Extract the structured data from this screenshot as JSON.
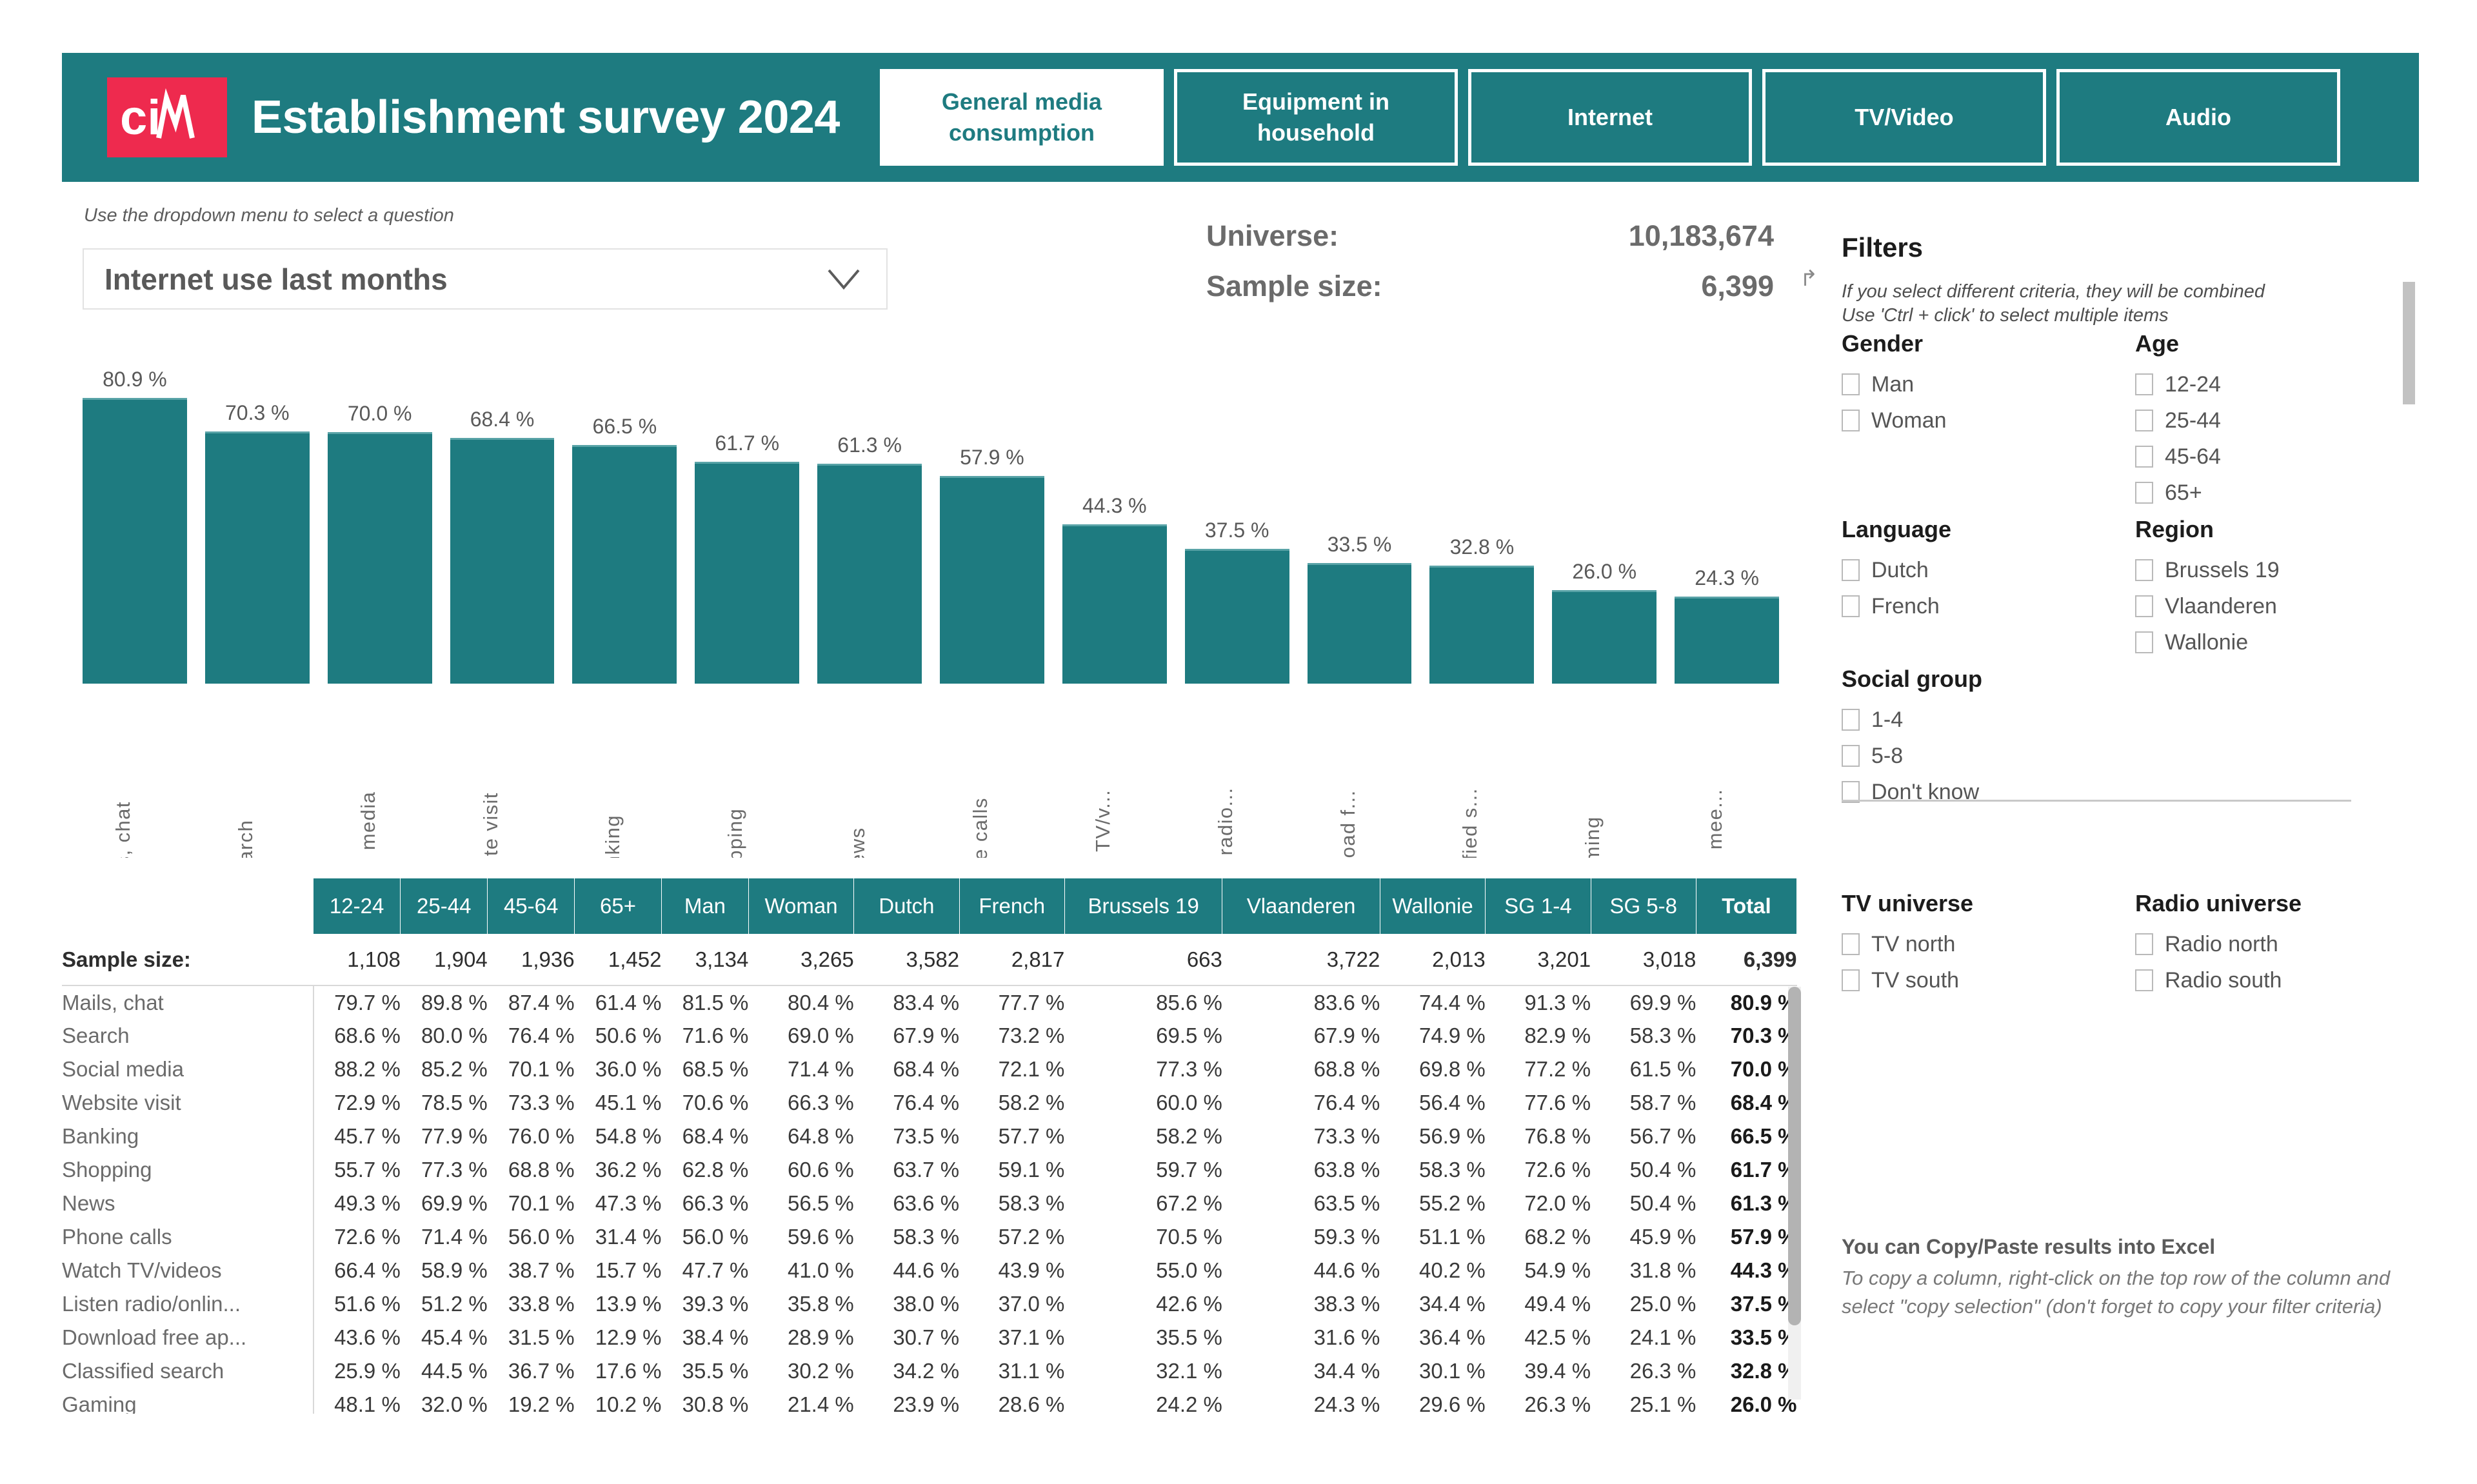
{
  "header": {
    "logo_text": "ciM",
    "title": "Establishment survey 2024",
    "tabs": [
      {
        "label": "General media consumption",
        "active": true
      },
      {
        "label": "Equipment in household",
        "active": false
      },
      {
        "label": "Internet",
        "active": false
      },
      {
        "label": "TV/Video",
        "active": false
      },
      {
        "label": "Audio",
        "active": false
      }
    ]
  },
  "question": {
    "hint": "Use the dropdown menu to select a question",
    "selected": "Internet use last months",
    "chevron_icon": "chevron-down-icon"
  },
  "stats": {
    "universe_label": "Universe:",
    "universe_value": "10,183,674",
    "sample_label": "Sample size:",
    "sample_value": "6,399",
    "marker": "↱"
  },
  "chart_data": {
    "type": "bar",
    "title": "Internet use last months",
    "xlabel": "",
    "ylabel": "",
    "ylim": [
      0,
      100
    ],
    "grid": false,
    "legend": "none",
    "categories": [
      "Mails, chat",
      "Search",
      "Social media",
      "Website visit",
      "Banking",
      "Shopping",
      "News",
      "Phone calls",
      "Watch TV/v...",
      "Listen radio...",
      "Download f...",
      "Classified s...",
      "Gaming",
      "Online mee..."
    ],
    "values": [
      80.9,
      70.3,
      70.0,
      68.4,
      66.5,
      61.7,
      61.3,
      57.9,
      44.3,
      37.5,
      33.5,
      32.8,
      26.0,
      24.3
    ],
    "value_labels": [
      "80.9 %",
      "70.3 %",
      "70.0 %",
      "68.4 %",
      "66.5 %",
      "61.7 %",
      "61.3 %",
      "57.9 %",
      "44.3 %",
      "37.5 %",
      "33.5 %",
      "32.8 %",
      "26.0 %",
      "24.3 %"
    ],
    "bar_color": "#1e7b80"
  },
  "table": {
    "row_header_label": "",
    "columns": [
      "12-24",
      "25-44",
      "45-64",
      "65+",
      "Man",
      "Woman",
      "Dutch",
      "French",
      "Brussels 19",
      "Vlaanderen",
      "Wallonie",
      "SG 1-4",
      "SG 5-8",
      "Total"
    ],
    "sample_size": {
      "label": "Sample size:",
      "values": [
        "1,108",
        "1,904",
        "1,936",
        "1,452",
        "3,134",
        "3,265",
        "3,582",
        "2,817",
        "663",
        "3,722",
        "2,013",
        "3,201",
        "3,018",
        "6,399"
      ]
    },
    "rows": [
      {
        "label": "Mails, chat",
        "values": [
          "79.7 %",
          "89.8 %",
          "87.4 %",
          "61.4 %",
          "81.5 %",
          "80.4 %",
          "83.4 %",
          "77.7 %",
          "85.6 %",
          "83.6 %",
          "74.4 %",
          "91.3 %",
          "69.9 %",
          "80.9 %"
        ]
      },
      {
        "label": "Search",
        "values": [
          "68.6 %",
          "80.0 %",
          "76.4 %",
          "50.6 %",
          "71.6 %",
          "69.0 %",
          "67.9 %",
          "73.2 %",
          "69.5 %",
          "67.9 %",
          "74.9 %",
          "82.9 %",
          "58.3 %",
          "70.3 %"
        ]
      },
      {
        "label": "Social media",
        "values": [
          "88.2 %",
          "85.2 %",
          "70.1 %",
          "36.0 %",
          "68.5 %",
          "71.4 %",
          "68.4 %",
          "72.1 %",
          "77.3 %",
          "68.8 %",
          "69.8 %",
          "77.2 %",
          "61.5 %",
          "70.0 %"
        ]
      },
      {
        "label": "Website visit",
        "values": [
          "72.9 %",
          "78.5 %",
          "73.3 %",
          "45.1 %",
          "70.6 %",
          "66.3 %",
          "76.4 %",
          "58.2 %",
          "60.0 %",
          "76.4 %",
          "56.4 %",
          "77.6 %",
          "58.7 %",
          "68.4 %"
        ]
      },
      {
        "label": "Banking",
        "values": [
          "45.7 %",
          "77.9 %",
          "76.0 %",
          "54.8 %",
          "68.4 %",
          "64.8 %",
          "73.5 %",
          "57.7 %",
          "58.2 %",
          "73.3 %",
          "56.9 %",
          "76.8 %",
          "56.7 %",
          "66.5 %"
        ]
      },
      {
        "label": "Shopping",
        "values": [
          "55.7 %",
          "77.3 %",
          "68.8 %",
          "36.2 %",
          "62.8 %",
          "60.6 %",
          "63.7 %",
          "59.1 %",
          "59.7 %",
          "63.8 %",
          "58.3 %",
          "72.6 %",
          "50.4 %",
          "61.7 %"
        ]
      },
      {
        "label": "News",
        "values": [
          "49.3 %",
          "69.9 %",
          "70.1 %",
          "47.3 %",
          "66.3 %",
          "56.5 %",
          "63.6 %",
          "58.3 %",
          "67.2 %",
          "63.5 %",
          "55.2 %",
          "72.0 %",
          "50.4 %",
          "61.3 %"
        ]
      },
      {
        "label": "Phone calls",
        "values": [
          "72.6 %",
          "71.4 %",
          "56.0 %",
          "31.4 %",
          "56.0 %",
          "59.6 %",
          "58.3 %",
          "57.2 %",
          "70.5 %",
          "59.3 %",
          "51.1 %",
          "68.2 %",
          "45.9 %",
          "57.9 %"
        ]
      },
      {
        "label": "Watch TV/videos",
        "values": [
          "66.4 %",
          "58.9 %",
          "38.7 %",
          "15.7 %",
          "47.7 %",
          "41.0 %",
          "44.6 %",
          "43.9 %",
          "55.0 %",
          "44.6 %",
          "40.2 %",
          "54.9 %",
          "31.8 %",
          "44.3 %"
        ]
      },
      {
        "label": "Listen radio/onlin...",
        "values": [
          "51.6 %",
          "51.2 %",
          "33.8 %",
          "13.9 %",
          "39.3 %",
          "35.8 %",
          "38.0 %",
          "37.0 %",
          "42.6 %",
          "38.3 %",
          "34.4 %",
          "49.4 %",
          "25.0 %",
          "37.5 %"
        ]
      },
      {
        "label": "Download free ap...",
        "values": [
          "43.6 %",
          "45.4 %",
          "31.5 %",
          "12.9 %",
          "38.4 %",
          "28.9 %",
          "30.7 %",
          "37.1 %",
          "35.5 %",
          "31.6 %",
          "36.4 %",
          "42.5 %",
          "24.1 %",
          "33.5 %"
        ]
      },
      {
        "label": "Classified search",
        "values": [
          "25.9 %",
          "44.5 %",
          "36.7 %",
          "17.6 %",
          "35.5 %",
          "30.2 %",
          "34.2 %",
          "31.1 %",
          "32.1 %",
          "34.4 %",
          "30.1 %",
          "39.4 %",
          "26.3 %",
          "32.8 %"
        ]
      },
      {
        "label": "Gaming",
        "values": [
          "48.1 %",
          "32.0 %",
          "19.2 %",
          "10.2 %",
          "30.8 %",
          "21.4 %",
          "23.9 %",
          "28.6 %",
          "24.2 %",
          "24.3 %",
          "29.6 %",
          "26.3 %",
          "25.1 %",
          "26.0 %"
        ]
      }
    ]
  },
  "filters": {
    "title": "Filters",
    "note_line1": "If you select different criteria, they will be combined",
    "note_line2": "Use 'Ctrl + click' to select multiple items",
    "groups": [
      {
        "title": "Gender",
        "items": [
          "Man",
          "Woman"
        ]
      },
      {
        "title": "Age",
        "items": [
          "12-24",
          "25-44",
          "45-64",
          "65+"
        ]
      },
      {
        "title": "Language",
        "items": [
          "Dutch",
          "French"
        ]
      },
      {
        "title": "Region",
        "items": [
          "Brussels 19",
          "Vlaanderen",
          "Wallonie"
        ]
      },
      {
        "title": "Social group",
        "items": [
          "1-4",
          "5-8",
          "Don't know"
        ]
      }
    ],
    "universe_groups": [
      {
        "title": "TV universe",
        "items": [
          "TV north",
          "TV south"
        ]
      },
      {
        "title": "Radio universe",
        "items": [
          "Radio north",
          "Radio south"
        ]
      }
    ]
  },
  "excel_note": {
    "title": "You can Copy/Paste results into Excel",
    "body": "To copy a column, right-click on the top row of the column and select \"copy selection\" (don't forget to copy your filter criteria)"
  },
  "colors": {
    "brand_teal": "#1e7b80",
    "logo_red": "#ee2a4e",
    "bar": "#1e7b80"
  }
}
